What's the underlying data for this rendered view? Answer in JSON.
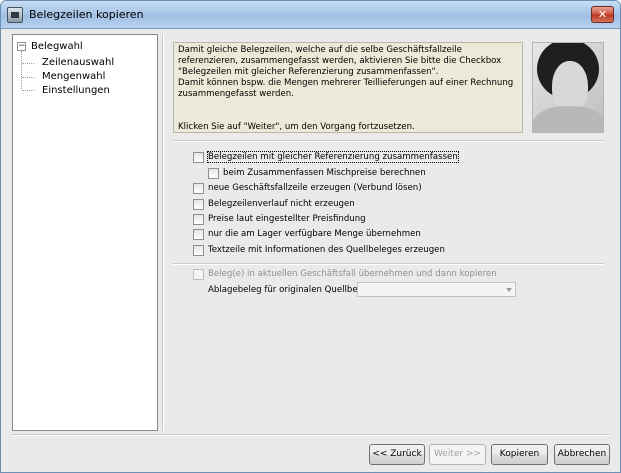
{
  "window": {
    "title": "Belegzeilen kopieren",
    "close_glyph": "✕"
  },
  "tree": {
    "root": "Belegwahl",
    "toggle": "−",
    "items": [
      {
        "label": "Zeilenauswahl",
        "selected": false
      },
      {
        "label": "Mengenwahl",
        "selected": false
      },
      {
        "label": "Einstellungen",
        "selected": true
      }
    ]
  },
  "info": {
    "lines": [
      "Damit gleiche Belegzeilen, welche auf die selbe Geschäftsfallzeile",
      "referenzieren, zusammengefasst werden, aktivieren Sie bitte die Checkbox",
      "\"Belegzeilen mit gleicher Referenzierung zusammenfassen\".",
      "Damit können bspw. die Mengen mehrerer Teillieferungen auf einer Rechnung",
      "zusammengefasst werden."
    ],
    "footer": "Klicken Sie auf \"Weiter\", um den Vorgang fortzusetzen."
  },
  "options": {
    "merge_same_reference": "Belegzeilen mit gleicher Referenzierung zusammenfassen",
    "mixed_prices": "beim Zusammenfassen Mischpreise berechnen",
    "new_business_line": "neue Geschäftsfallzeile erzeugen (Verbund lösen)",
    "no_history": "Belegzeilenverlauf nicht erzeugen",
    "price_finding": "Preise laut eingestellter Preisfindung",
    "available_stock_only": "nur die am Lager verfügbare Menge übernehmen",
    "text_line_source_info": "Textzeile mit Informationen des Quellbeleges erzeugen",
    "take_into_current_case": "Beleg(e) in aktuellen Geschäftsfall übernehmen und dann kopieren",
    "archive_label": "Ablagebeleg für originalen Quellbeleg",
    "archive_value": ""
  },
  "buttons": {
    "back": "<< Zurück",
    "next": "Weiter >>",
    "copy": "Kopieren",
    "cancel": "Abbrechen"
  },
  "colors": {
    "info_background": "#ece9d8",
    "titlebar": "#b7d2ef"
  },
  "icons": {
    "app": "app-icon",
    "close": "close-icon",
    "tree_toggle": "tree-collapse-icon",
    "dropdown": "chevron-down-icon"
  }
}
